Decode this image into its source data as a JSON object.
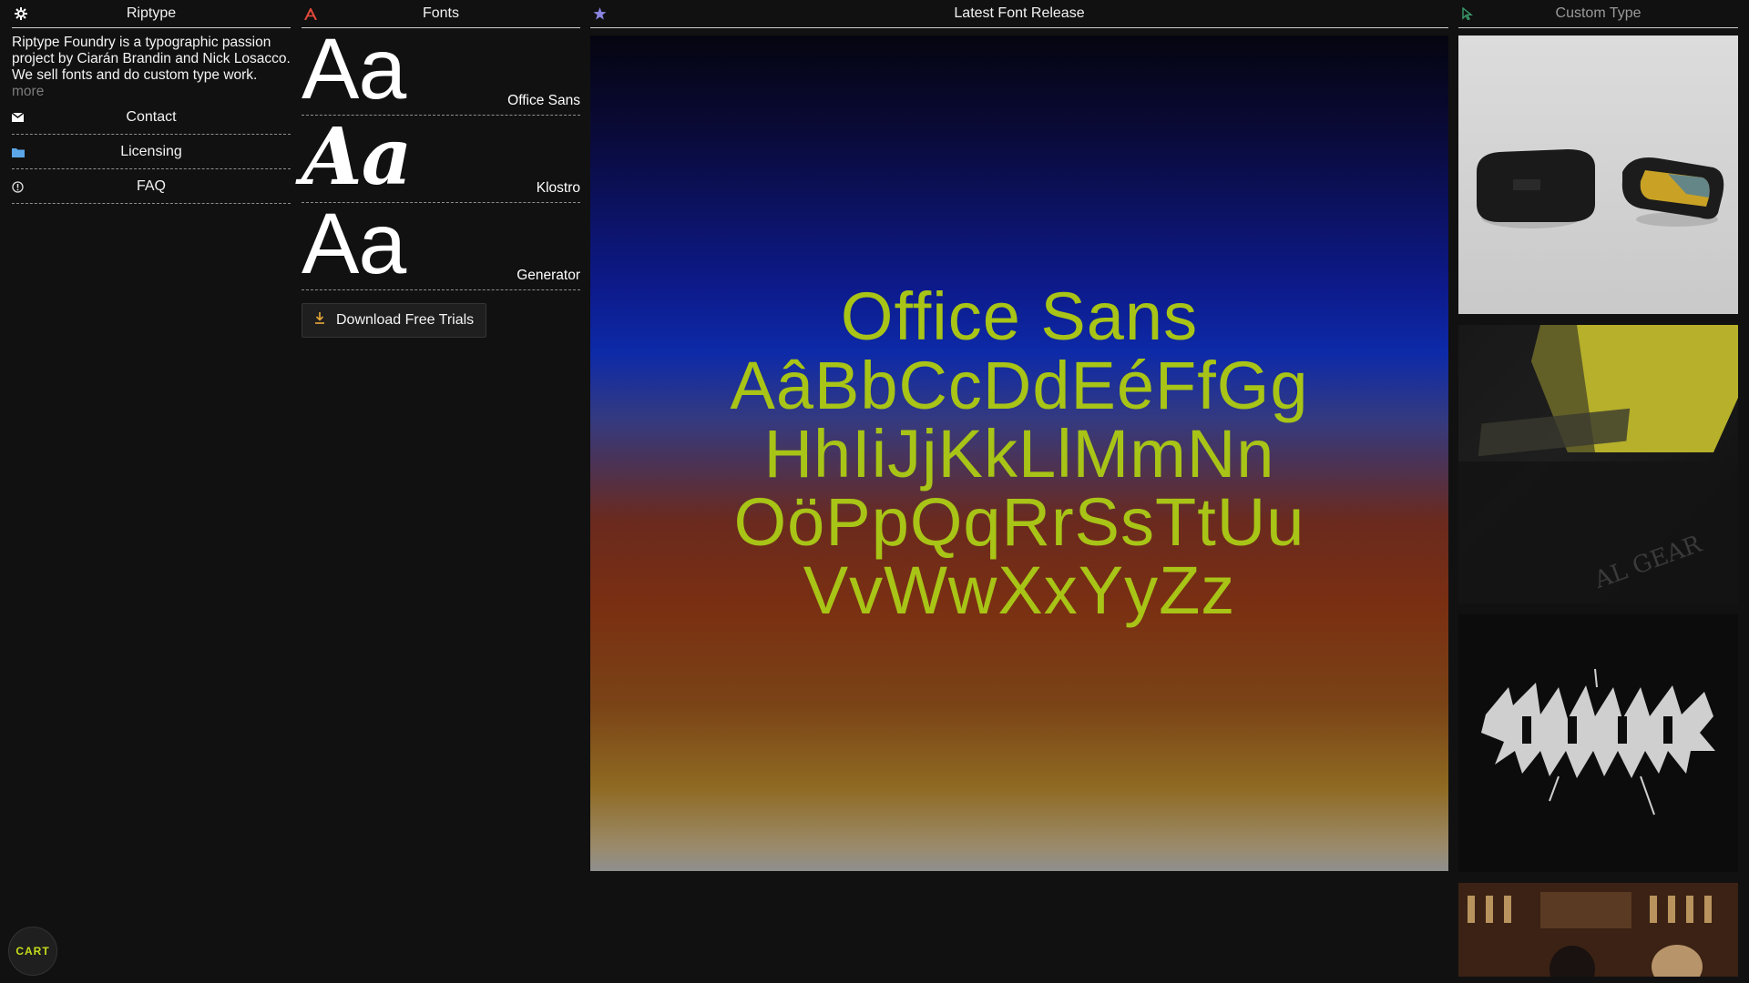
{
  "brand": {
    "title": "Riptype",
    "icon": "gear-icon"
  },
  "about": {
    "text": "Riptype Foundry is a typographic passion project by Ciarán Brandin and Nick Losacco. We sell fonts and do custom type work.",
    "more": "more"
  },
  "nav": [
    {
      "label": "Contact",
      "icon": "mail-icon"
    },
    {
      "label": "Licensing",
      "icon": "folder-icon"
    },
    {
      "label": "FAQ",
      "icon": "info-icon"
    }
  ],
  "fonts": {
    "title": "Fonts",
    "icon": "letter-a-icon",
    "items": [
      {
        "name": "Office Sans",
        "glyph": "Aa"
      },
      {
        "name": "Klostro",
        "glyph": "Aa"
      },
      {
        "name": "Generator",
        "glyph": "Aa"
      }
    ],
    "download_label": "Download Free Trials"
  },
  "latest": {
    "title": "Latest Font Release",
    "icon": "star-icon",
    "lines": [
      "Office Sans",
      "AâBbCcDdEéFfGg",
      "HhIiJjKkLlMmNn",
      "OöPpQqRrSsTtUu",
      "VvWwXxYyZz"
    ]
  },
  "custom": {
    "title": "Custom Type",
    "icon": "cursor-icon"
  },
  "cart": {
    "label": "CART"
  },
  "colors": {
    "accent_lime": "#a8c416",
    "cart_text": "#c6dd1a",
    "background": "#111111"
  }
}
